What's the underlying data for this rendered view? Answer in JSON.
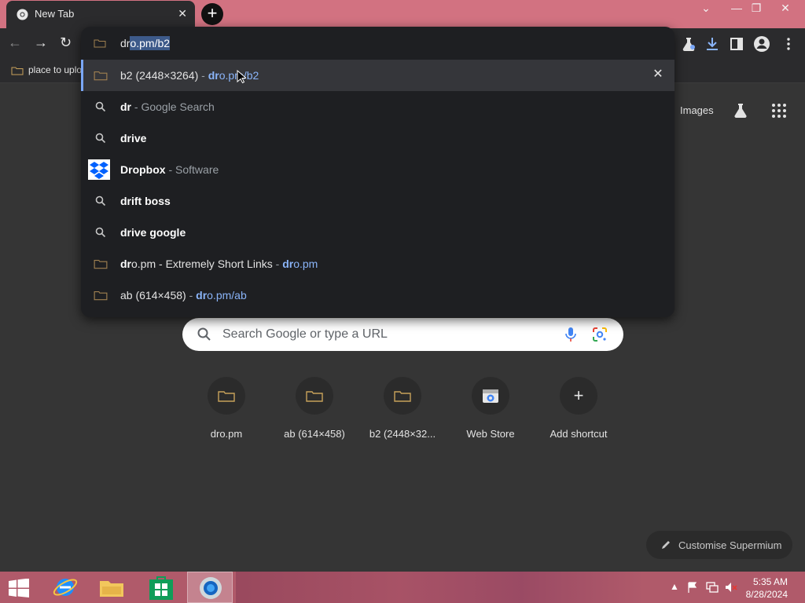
{
  "tab": {
    "title": "New Tab",
    "close": "✕"
  },
  "window_controls": {
    "dropdown": "⌄",
    "minimize": "—",
    "restore": "❐",
    "close": "✕"
  },
  "toolbar": {
    "back": "←",
    "forward": "→",
    "reload": "↻"
  },
  "bookmarks": {
    "item1": "place to uplo"
  },
  "omnibox": {
    "input_plain": "dr",
    "input_selected": "o.pm/b2",
    "suggestions": [
      {
        "icon": "folder-icon",
        "bold": "",
        "text": "b2 (2448×3264)",
        "sep": " - ",
        "url_bold": "dr",
        "url": "o.pm/b2",
        "selected": true
      },
      {
        "icon": "search-icon",
        "bold": "dr",
        "text": "",
        "sep": " - ",
        "dim": "Google Search"
      },
      {
        "icon": "search-icon",
        "bold": "dr",
        "rest": "ive"
      },
      {
        "icon": "dropbox-icon",
        "bold": "Dr",
        "rest": "opbox",
        "sep": " - ",
        "dim": "Software"
      },
      {
        "icon": "search-icon",
        "bold": "dr",
        "rest": "ift boss"
      },
      {
        "icon": "search-icon",
        "bold": "dr",
        "rest": "ive google"
      },
      {
        "icon": "folder-icon",
        "bold": "dr",
        "text": "o.pm - Extremely Short Links",
        "sep": " - ",
        "url_bold": "dr",
        "url": "o.pm"
      },
      {
        "icon": "folder-icon",
        "text": "ab (614×458)",
        "sep": " - ",
        "url_bold": "dr",
        "url": "o.pm/ab"
      }
    ]
  },
  "ntp": {
    "images_link": "Images",
    "search_placeholder": "Search Google or type a URL",
    "shortcuts": [
      {
        "label": "dro.pm"
      },
      {
        "label": "ab (614×458)"
      },
      {
        "label": "b2 (2448×32..."
      },
      {
        "label": "Web Store"
      },
      {
        "label": "Add shortcut"
      }
    ],
    "customise": "Customise Supermium"
  },
  "taskbar": {
    "time": "5:35 AM",
    "date": "8/28/2024"
  },
  "colors": {
    "accent": "#8ab4f8",
    "titlebar": "#d27281",
    "taskbar": "#b05a6a"
  }
}
